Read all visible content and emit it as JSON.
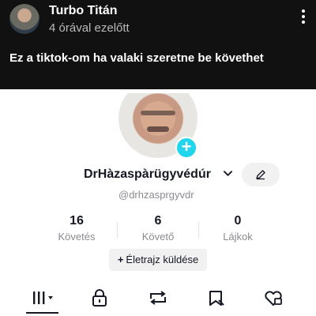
{
  "post": {
    "author": "Turbo Titán",
    "time": "4 órával ezelőtt",
    "caption": "Ez a tiktok-om  ha valaki szeretne be követhet",
    "more_icon": "more-vertical-icon"
  },
  "profile": {
    "username": "DrHàzaspàrügyvédúr",
    "handle": "@drhzasprgyvdr",
    "stats": [
      {
        "value": "16",
        "label": "Követés"
      },
      {
        "value": "6",
        "label": "Követő"
      },
      {
        "value": "0",
        "label": "Lájkok"
      }
    ],
    "bio_button": "Életrajz küldése",
    "add_color": "#20d5ec"
  },
  "tabs": [
    {
      "icon": "grid-icon",
      "active": true
    },
    {
      "icon": "lock-icon"
    },
    {
      "icon": "repost-icon"
    },
    {
      "icon": "saved-icon"
    },
    {
      "icon": "liked-icon"
    }
  ]
}
